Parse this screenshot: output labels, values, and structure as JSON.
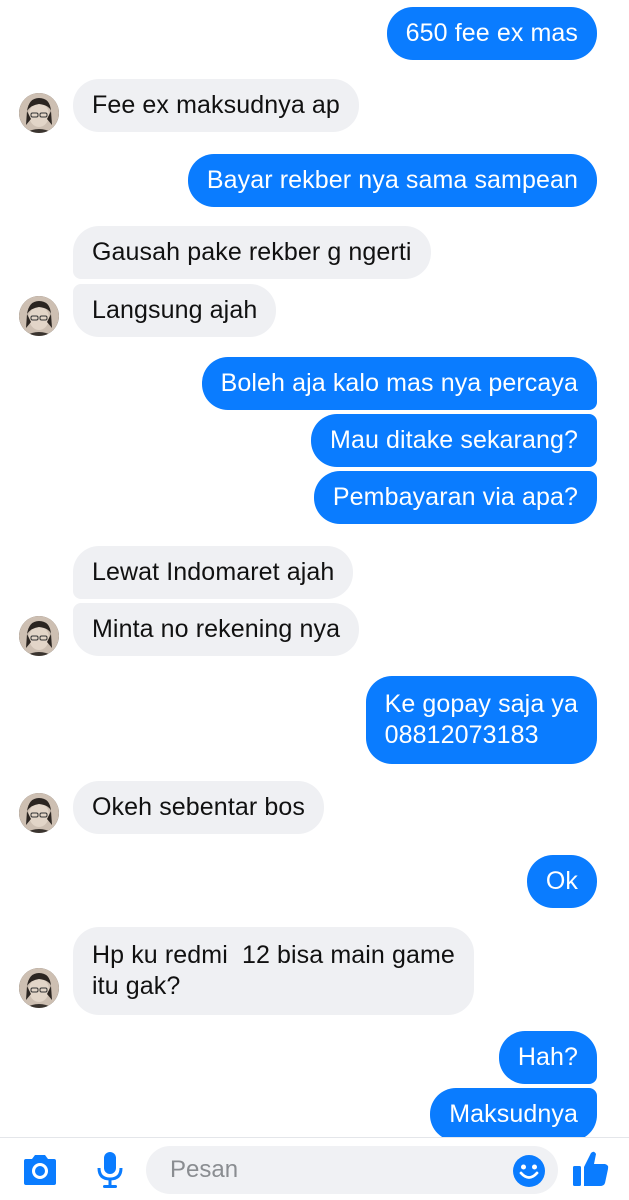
{
  "messages": [
    {
      "side": "out",
      "text": "650 fee ex mas"
    },
    {
      "side": "in",
      "text": "Fee ex maksudnya ap"
    },
    {
      "side": "out",
      "text": "Bayar rekber nya sama sampean"
    },
    {
      "side": "in",
      "text": "Gausah pake rekber g ngerti"
    },
    {
      "side": "in",
      "text": "Langsung ajah"
    },
    {
      "side": "out",
      "text": "Boleh aja kalo mas nya percaya"
    },
    {
      "side": "out",
      "text": "Mau ditake sekarang?"
    },
    {
      "side": "out",
      "text": "Pembayaran via apa?"
    },
    {
      "side": "in",
      "text": "Lewat Indomaret ajah"
    },
    {
      "side": "in",
      "text": "Minta no rekening nya"
    },
    {
      "side": "out",
      "text": "Ke gopay saja ya\n08812073183"
    },
    {
      "side": "in",
      "text": "Okeh sebentar bos"
    },
    {
      "side": "out",
      "text": "Ok"
    },
    {
      "side": "in",
      "text": "Hp ku redmi  12 bisa main game\nitu gak?"
    },
    {
      "side": "out",
      "text": "Hah?"
    },
    {
      "side": "out",
      "text": "Maksudnya"
    }
  ],
  "composer": {
    "placeholder": "Pesan",
    "camera_icon": "camera-icon",
    "mic_icon": "microphone-icon",
    "emoji_icon": "emoji-icon",
    "like_icon": "thumbs-up-icon"
  },
  "colors": {
    "outgoing_bubble": "#0a7cff",
    "incoming_bubble": "#eff0f3",
    "icon_blue": "#0a7cff"
  }
}
